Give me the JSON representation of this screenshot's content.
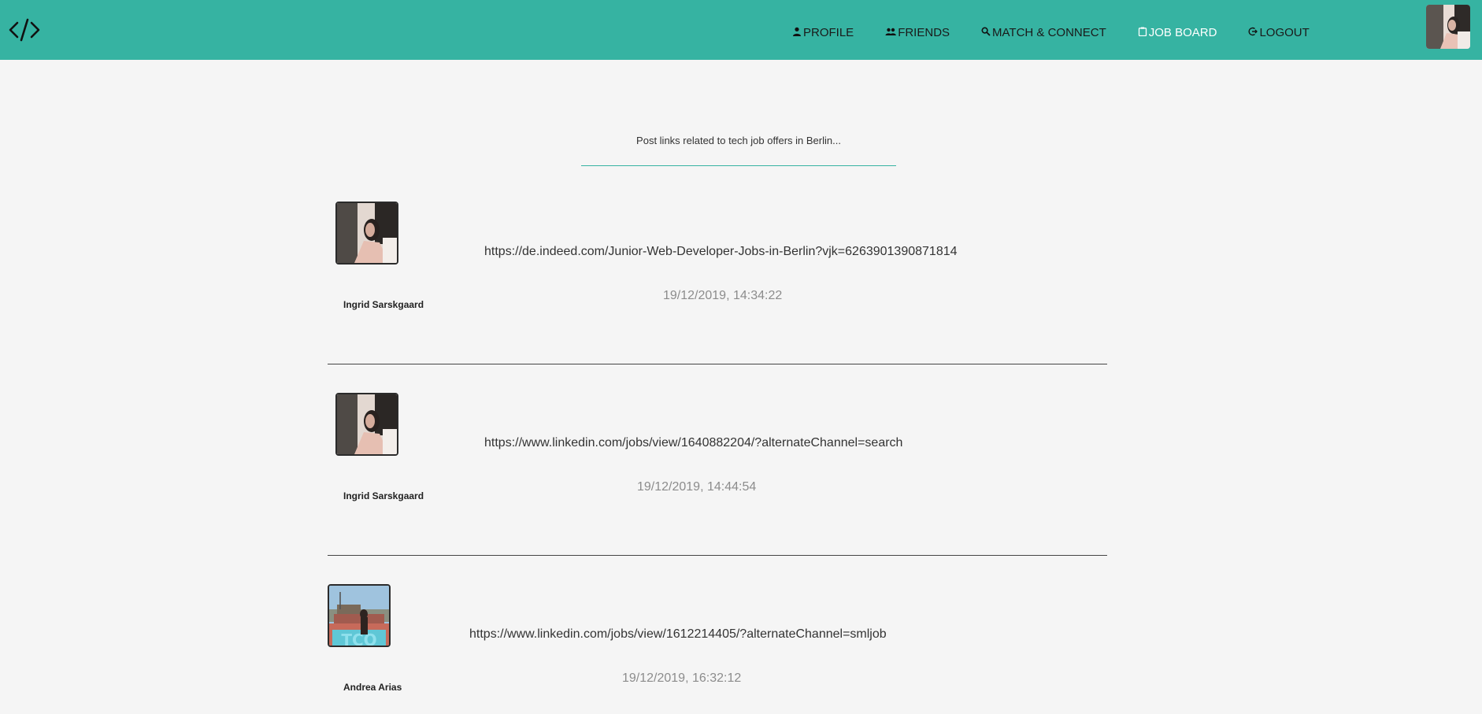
{
  "nav": {
    "items": [
      {
        "label": "PROFILE",
        "icon": "person-icon"
      },
      {
        "label": "FRIENDS",
        "icon": "people-icon"
      },
      {
        "label": "MATCH & CONNECT",
        "icon": "search-icon"
      },
      {
        "label": "JOB BOARD",
        "icon": "clipboard-icon"
      },
      {
        "label": "LOGOUT",
        "icon": "logout-icon"
      }
    ]
  },
  "post_input": {
    "placeholder": "Post links related to tech job offers in Berlin..."
  },
  "posts": [
    {
      "author": "Ingrid Sarskgaard",
      "link": "https://de.indeed.com/Junior-Web-Developer-Jobs-in-Berlin?vjk=6263901390871814",
      "time": "19/12/2019, 14:34:22"
    },
    {
      "author": "Ingrid Sarskgaard",
      "link": "https://www.linkedin.com/jobs/view/1640882204/?alternateChannel=search",
      "time": "19/12/2019, 14:44:54"
    },
    {
      "author": "Andrea Arias",
      "link": "https://www.linkedin.com/jobs/view/1612214405/?alternateChannel=smljob",
      "time": "19/12/2019, 16:32:12"
    }
  ],
  "colors": {
    "navbar": "#36b3a2",
    "background": "#f5f5f5",
    "input_underline": "#36b3a2"
  }
}
